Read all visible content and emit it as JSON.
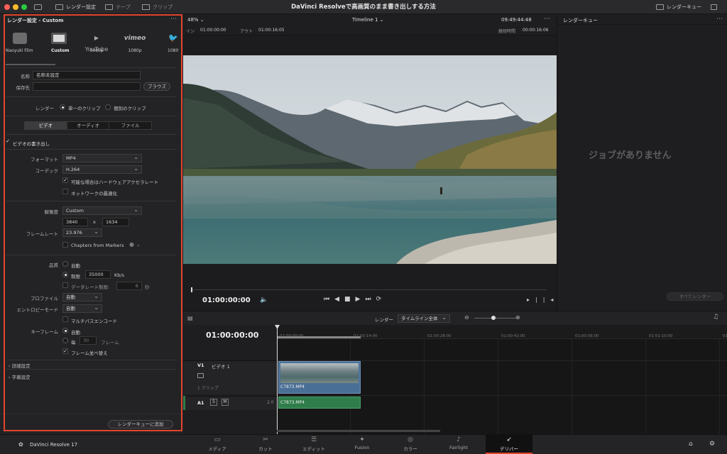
{
  "title_bar": {
    "render_settings_label": "レンダー設定",
    "tape_label": "テープ",
    "clip_label": "クリップ",
    "app_title": "DaVinci Resolveで高画質のまま書き出しする方法",
    "render_queue_label": "レンダーキュー"
  },
  "left_panel": {
    "header": "レンダー設定 - Custom",
    "presets": [
      {
        "name": "Naoyuki Film",
        "icon": "film-icon"
      },
      {
        "name": "Custom",
        "icon": "custom-film-icon"
      },
      {
        "name": "1080p",
        "icon": "youtube-icon"
      },
      {
        "name": "1080p",
        "icon": "vimeo-icon"
      },
      {
        "name": "1080",
        "icon": "twitter-icon"
      }
    ],
    "name_label": "名称",
    "name_value": "名称未設定",
    "location_label": "保存先",
    "browse_button": "ブラウズ",
    "render_label": "レンダー",
    "single_clip": "単一のクリップ",
    "individual_clips": "個別のクリップ",
    "tabs": [
      "ビデオ",
      "オーディオ",
      "ファイル"
    ],
    "export_video": "ビデオの書き出し",
    "format_label": "フォーマット",
    "format_value": "MP4",
    "codec_label": "コーデック",
    "codec_value": "H.264",
    "hw_accel": "可能な場合はハードウェアアクセラレート",
    "network_opt": "ネットワークの最適化",
    "resolution_label": "解像度",
    "resolution_value": "Custom",
    "width": "3840",
    "x_sep": "x",
    "height": "1634",
    "framerate_label": "フレームレート",
    "framerate_value": "23.976",
    "chapters": "Chapters from Markers",
    "quality_label": "品質",
    "quality_auto": "自動",
    "quality_limit": "制限",
    "quality_value": "35000",
    "quality_unit": "Kb/s",
    "datarate_limit": "データレート制限:",
    "datarate_value": "6",
    "datarate_unit": "秒",
    "profile_label": "プロファイル",
    "profile_value": "自動",
    "entropy_label": "エントロピーモード",
    "entropy_value": "自動",
    "multipass": "マルチパスエンコード",
    "keyframe_label": "キーフレーム",
    "keyframe_auto": "自動",
    "keyframe_every": "毎",
    "keyframe_value": "30",
    "keyframe_unit": "フレーム",
    "frame_reorder": "フレーム並べ替え",
    "advanced": "詳細設定",
    "subtitles": "字幕設定",
    "add_to_queue": "レンダーキューに追加"
  },
  "viewer": {
    "zoom": "48%",
    "timeline_name": "Timeline 1",
    "timecode_top": "09:49:44:48",
    "in_label": "イン",
    "in_value": "01:00:00:00",
    "out_label": "アウト",
    "out_value": "01:00:16:05",
    "duration_label": "継続時間",
    "duration_value": "00:00:16:06",
    "current_timecode": "01:00:00:00"
  },
  "render_queue": {
    "title": "レンダーキュー",
    "empty_text": "ジョブがありません",
    "render_all": "すべてレンダー"
  },
  "timeline": {
    "render_label": "レンダー",
    "range_value": "タイムライン全体",
    "timecode": "01:00:00:00",
    "ticks": [
      "01:00:00:00",
      "01:00:14:00",
      "01:00:28:00",
      "01:00:42:00",
      "01:00:56:00",
      "01:01:10:00",
      "01:01:24:00"
    ],
    "v1_label": "V1",
    "v1_name": "ビデオ 1",
    "v1_clips": "1 クリップ",
    "a1_label": "A1",
    "a1_s": "S",
    "a1_m": "M",
    "a1_level": "2.0",
    "video_clip": "C7873.MP4",
    "audio_clip": "C7873.MP4"
  },
  "bottom_nav": {
    "brand": "DaVinci Resolve 17",
    "items": [
      "メディア",
      "カット",
      "エディット",
      "Fusion",
      "カラー",
      "Fairlight",
      "デリバー"
    ]
  },
  "colors": {
    "accent": "#e2452d",
    "video_clip": "#4a6f96",
    "audio_clip": "#2f7d4a"
  }
}
